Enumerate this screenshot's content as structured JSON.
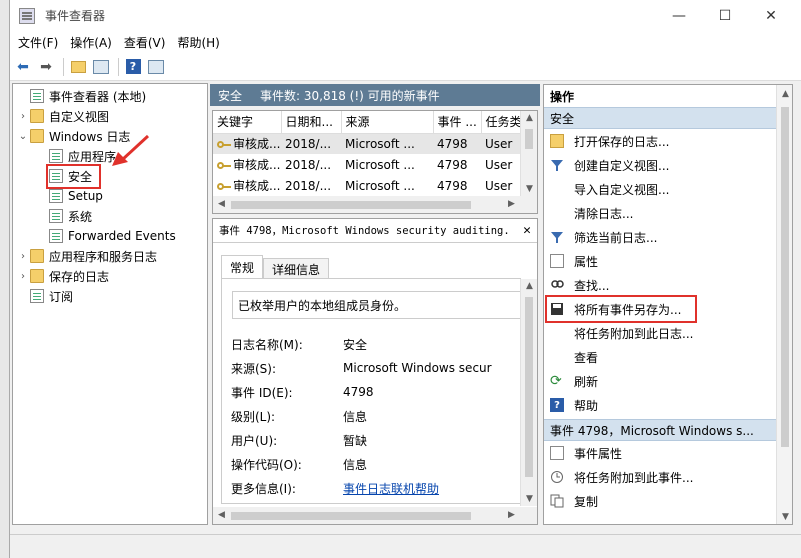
{
  "window": {
    "title": "事件查看器"
  },
  "menu": [
    "文件(F)",
    "操作(A)",
    "查看(V)",
    "帮助(H)"
  ],
  "tree": {
    "root": "事件查看器 (本地)",
    "custom_views": "自定义视图",
    "windows_logs": "Windows 日志",
    "application": "应用程序",
    "security": "安全",
    "setup": "Setup",
    "system": "系统",
    "forwarded": "Forwarded Events",
    "app_services": "应用程序和服务日志",
    "saved_logs": "保存的日志",
    "subscriptions": "订阅"
  },
  "center": {
    "log_name": "安全",
    "event_count": "事件数: 30,818 (!) 可用的新事件",
    "columns": [
      "关键字",
      "日期和...",
      "来源",
      "事件 ...",
      "任务类"
    ],
    "rows": [
      [
        "审核成...",
        "2018/...",
        "Microsoft ...",
        "4798",
        "User"
      ],
      [
        "审核成...",
        "2018/...",
        "Microsoft ...",
        "4798",
        "User"
      ],
      [
        "审核成...",
        "2018/...",
        "Microsoft ...",
        "4798",
        "User"
      ]
    ],
    "detail_title": "事件 4798，Microsoft Windows security auditing.",
    "tabs": [
      "常规",
      "详细信息"
    ],
    "description": "已枚举用户的本地组成员身份。",
    "props": [
      {
        "label": "日志名称(M):",
        "value": "安全"
      },
      {
        "label": "来源(S):",
        "value": "Microsoft Windows secur"
      },
      {
        "label": "事件 ID(E):",
        "value": "4798"
      },
      {
        "label": "级别(L):",
        "value": "信息"
      },
      {
        "label": "用户(U):",
        "value": "暂缺"
      },
      {
        "label": "操作代码(O):",
        "value": "信息"
      },
      {
        "label": "更多信息(I):",
        "value": "事件日志联机帮助"
      }
    ]
  },
  "actions": {
    "title": "操作",
    "section1": "安全",
    "items": [
      {
        "label": "打开保存的日志...",
        "icon": "folder-open-icon"
      },
      {
        "label": "创建自定义视图...",
        "icon": "filter-icon"
      },
      {
        "label": "导入自定义视图...",
        "icon": ""
      },
      {
        "label": "清除日志...",
        "icon": ""
      },
      {
        "label": "筛选当前日志...",
        "icon": "filter-icon"
      },
      {
        "label": "属性",
        "icon": "properties-icon"
      },
      {
        "label": "查找...",
        "icon": "find-icon"
      },
      {
        "label": "将所有事件另存为...",
        "icon": "save-icon"
      },
      {
        "label": "将任务附加到此日志...",
        "icon": ""
      },
      {
        "label": "查看",
        "icon": ""
      },
      {
        "label": "刷新",
        "icon": "refresh-icon"
      },
      {
        "label": "帮助",
        "icon": "help-icon"
      }
    ],
    "section2": "事件 4798，Microsoft Windows s...",
    "items2": [
      {
        "label": "事件属性",
        "icon": "properties-icon"
      },
      {
        "label": "将任务附加到此事件...",
        "icon": "task-icon"
      },
      {
        "label": "复制",
        "icon": "copy-icon"
      }
    ]
  },
  "colors": {
    "accent": "#5e7b94",
    "highlight": "#e0312b",
    "section_bg": "#d3e1ee"
  }
}
